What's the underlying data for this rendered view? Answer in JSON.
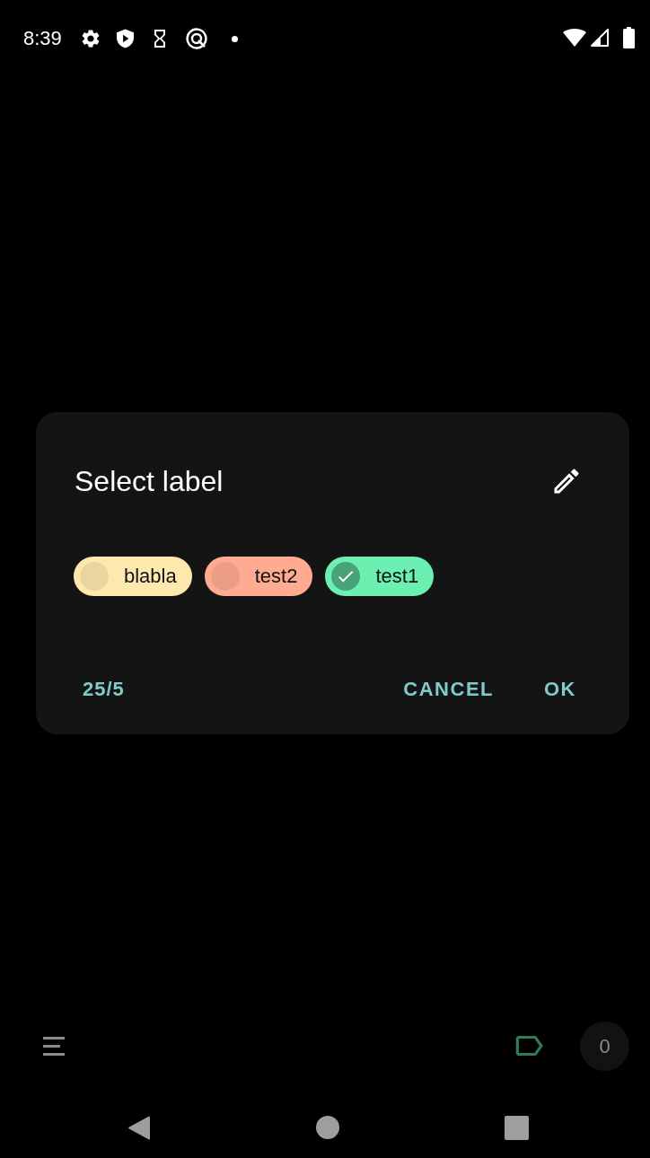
{
  "status_bar": {
    "time": "8:39"
  },
  "dialog": {
    "title": "Select label",
    "labels": [
      {
        "name": "blabla",
        "color": "#fde8ae",
        "selected": false
      },
      {
        "name": "test2",
        "color": "#ffab91",
        "selected": false
      },
      {
        "name": "test1",
        "color": "#6cf0b2",
        "selected": true
      }
    ],
    "counter": "25/5",
    "buttons": [
      "CANCEL",
      "OK"
    ]
  },
  "bottom_bar": {
    "count": "0"
  }
}
